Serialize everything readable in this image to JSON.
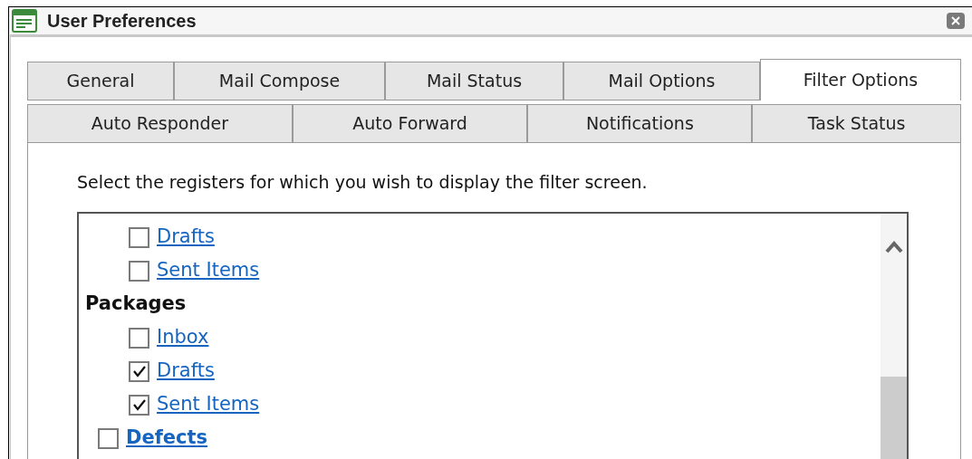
{
  "window": {
    "title": "User Preferences"
  },
  "tab_rows": [
    [
      {
        "label": "General",
        "selected": false
      },
      {
        "label": "Mail Compose",
        "selected": false
      },
      {
        "label": "Mail Status",
        "selected": false
      },
      {
        "label": "Mail Options",
        "selected": false
      },
      {
        "label": "Filter Options",
        "selected": true
      }
    ],
    [
      {
        "label": "Auto Responder",
        "selected": false
      },
      {
        "label": "Auto Forward",
        "selected": false
      },
      {
        "label": "Notifications",
        "selected": false
      },
      {
        "label": "Task Status",
        "selected": false
      }
    ]
  ],
  "instruction": "Select the registers for which you wish to display the filter screen.",
  "registers": [
    {
      "kind": "group-tail",
      "children": [
        {
          "label": "Drafts",
          "checked": false
        },
        {
          "label": "Sent Items",
          "checked": false
        }
      ]
    },
    {
      "kind": "group",
      "label": "Packages",
      "children": [
        {
          "label": "Inbox",
          "checked": false
        },
        {
          "label": "Drafts",
          "checked": true
        },
        {
          "label": "Sent Items",
          "checked": true
        }
      ]
    },
    {
      "kind": "register",
      "label": "Defects",
      "checked": false
    }
  ]
}
